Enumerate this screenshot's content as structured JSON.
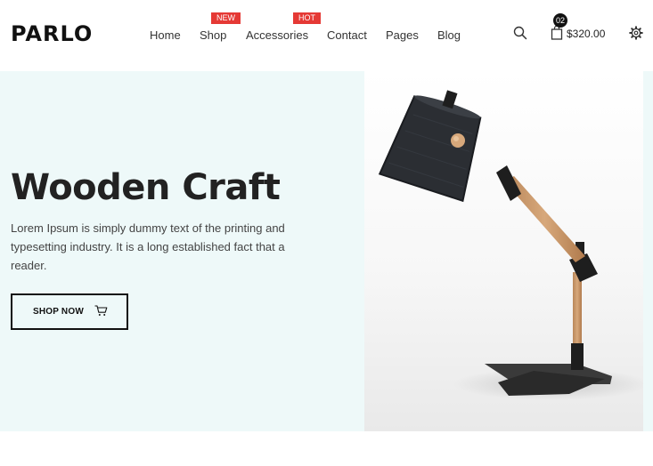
{
  "header": {
    "logo": "PARLO",
    "nav": [
      {
        "label": "Home",
        "badge": ""
      },
      {
        "label": "Shop",
        "badge": "NEW"
      },
      {
        "label": "Accessories",
        "badge": "HOT"
      },
      {
        "label": "Contact",
        "badge": ""
      },
      {
        "label": "Pages",
        "badge": ""
      },
      {
        "label": "Blog",
        "badge": ""
      }
    ],
    "search_icon": "search-icon",
    "cart": {
      "icon": "bag-icon",
      "count": "02",
      "total": "$320.00"
    },
    "settings_icon": "gear-icon"
  },
  "hero": {
    "title": "Wooden Craft",
    "text": "Lorem Ipsum is simply dummy text of the printing and typesetting industry. It is a long established fact that a reader.",
    "button": {
      "label": "SHOP NOW",
      "icon": "cart-icon"
    },
    "image": "desk-lamp-image"
  },
  "colors": {
    "badge": "#e53935",
    "hero_background": "#eef9f9",
    "text": "#222222"
  }
}
